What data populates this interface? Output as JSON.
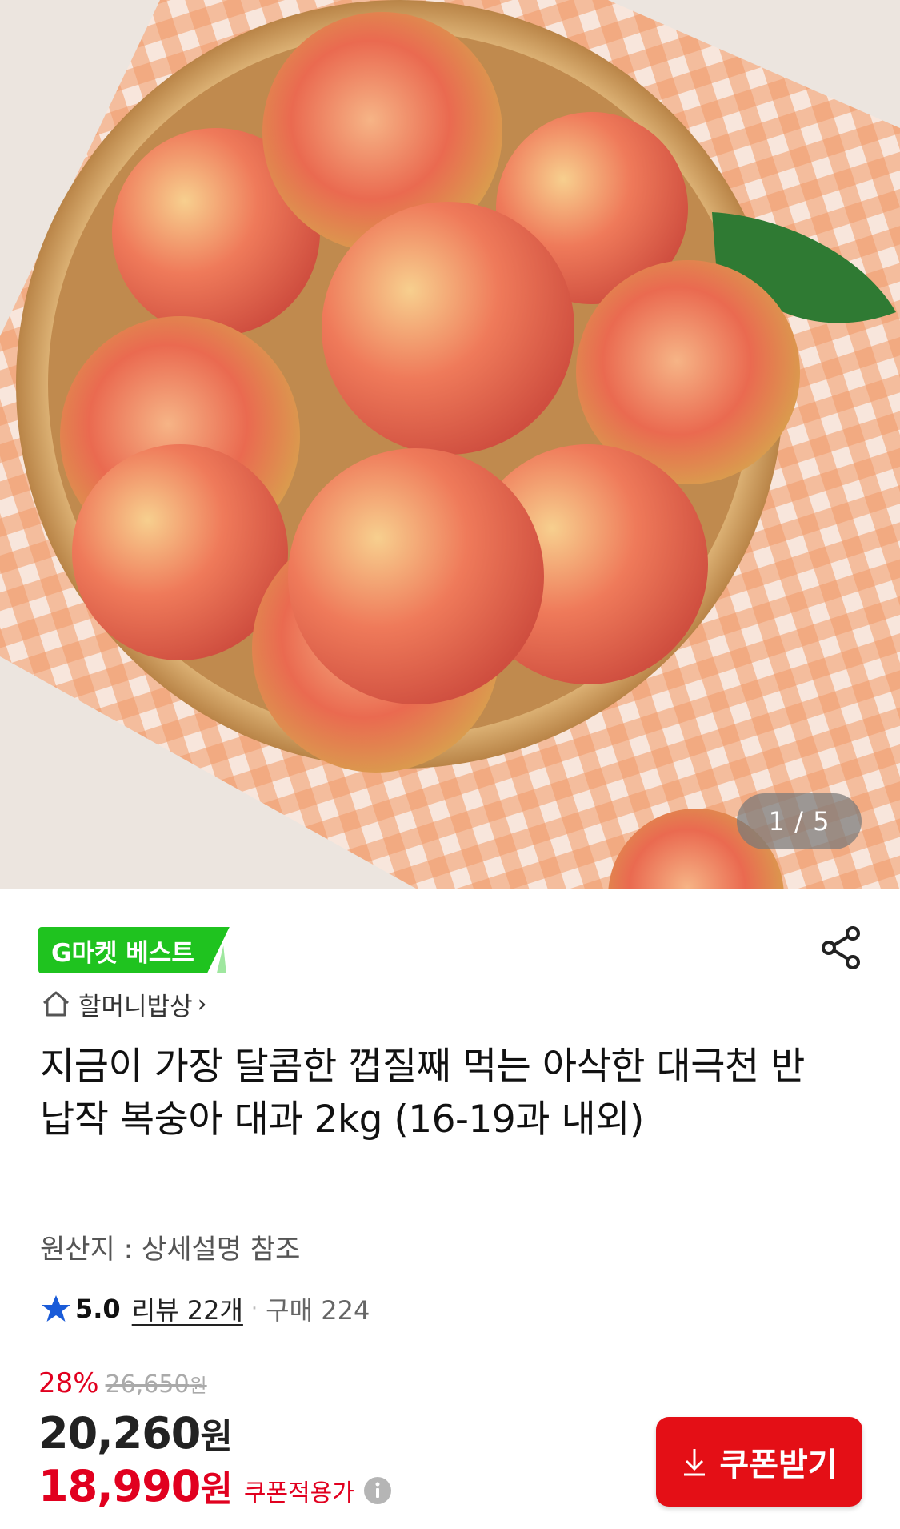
{
  "hero": {
    "image_description": "",
    "pager": "1 / 5"
  },
  "badge": {
    "label": "G마켓 베스트",
    "color": "#1fc31f"
  },
  "seller": {
    "name": "할머니밥상",
    "chevron": "›"
  },
  "product": {
    "title": "지금이 가장 달콤한 껍질째 먹는 아삭한 대극천 반납작 복숭아 대과 2kg (16-19과 내외)",
    "origin": "원산지 : 상세설명 참조"
  },
  "rating": {
    "score": "5.0",
    "reviews": "리뷰 22개",
    "separator": "·",
    "purchases": "구매 224",
    "star_color": "#1a5bd8"
  },
  "pricing": {
    "discount_pct": "28%",
    "original_price": "26,650",
    "original_unit": "원",
    "price": "20,260",
    "price_unit": "원",
    "coupon_price": "18,990",
    "coupon_unit": "원",
    "coupon_label": "쿠폰적용가",
    "accent_color": "#e1001f"
  },
  "coupon_button": {
    "label": "쿠폰받기",
    "color": "#e40f16"
  },
  "icons": {
    "share": "share-icon",
    "home": "home-icon",
    "star": "star-icon",
    "info": "info-icon",
    "download": "download-icon"
  }
}
